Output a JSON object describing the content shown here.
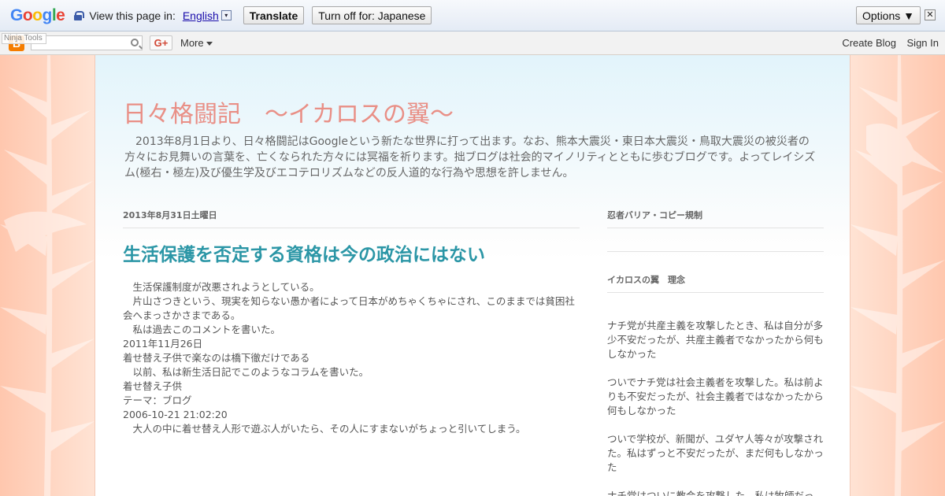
{
  "translate_bar": {
    "logo": "Google",
    "view_label": "View this page in:",
    "language": "English",
    "language_arrow": "▾",
    "translate_button": "Translate",
    "turn_off_button": "Turn off for: Japanese",
    "options_button": "Options ▼",
    "close_glyph": "✕"
  },
  "navbar": {
    "blogger_glyph": "B",
    "ninja_tools": "Ninja Tools",
    "gplus_label": "G+",
    "more_label": "More",
    "create_blog": "Create Blog",
    "sign_in": "Sign In"
  },
  "blog": {
    "title": "日々格闘記　～イカロスの翼～",
    "description": "　2013年8月1日より、日々格闘記はGoogleという新たな世界に打って出ます。なお、熊本大震災・東日本大震災・鳥取大震災の被災者の方々にお見舞いの言葉を、亡くなられた方々には冥福を祈ります。拙ブログは社会的マイノリティとともに歩むブログです。よってレイシズム(極右・極左)及び優生学及びエコテロリズムなどの反人道的な行為や思想を許しません。"
  },
  "post": {
    "date": "2013年8月31日土曜日",
    "title": "生活保護を否定する資格は今の政治にはない",
    "paragraphs": [
      "　生活保護制度が改悪されようとしている。",
      "",
      "　片山さつきという、現実を知らない愚か者によって日本がめちゃくちゃにされ、このままでは貧困社会へまっさかさまである。",
      "",
      "　私は過去このコメントを書いた。",
      "",
      "2011年11月26日",
      "着せ替え子供で楽なのは橋下徹だけである",
      "　以前、私は新生活日記でこのようなコラムを書いた。",
      "",
      "着せ替え子供",
      "テーマ：ブログ",
      "2006-10-21 21:02:20",
      "　大人の中に着せ替え人形で遊ぶ人がいたら、その人にすまないがちょっと引いてしまう。"
    ]
  },
  "sidebar": {
    "widget1_title": "忍者バリア・コピー規制",
    "widget2_title": "イカロスの翼　理念",
    "widget2_paragraphs": [
      "ナチ党が共産主義を攻撃したとき、私は自分が多少不安だったが、共産主義者でなかったから何もしなかった",
      "ついでナチ党は社会主義者を攻撃した。私は前よりも不安だったが、社会主義者ではなかったから何もしなかった",
      "ついで学校が、新聞が、ユダヤ人等々が攻撃された。私はずっと不安だったが、まだ何もしなかった",
      "ナチ党はついに教会を攻撃した。私は牧師だっ"
    ]
  },
  "colors": {
    "title": "#e98f86",
    "post_title": "#2b96a6",
    "text": "#555555",
    "background": "#ffe3d4"
  }
}
